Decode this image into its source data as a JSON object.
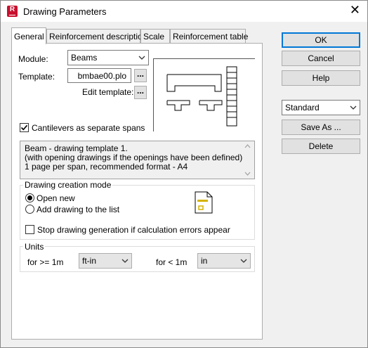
{
  "window": {
    "title": "Drawing Parameters",
    "close_glyph": "✕",
    "app_icon_letter": "R"
  },
  "tabs": [
    {
      "label": "General",
      "active": true
    },
    {
      "label": "Reinforcement description",
      "active": false
    },
    {
      "label": "Scale",
      "active": false
    },
    {
      "label": "Reinforcement table",
      "active": false
    }
  ],
  "general": {
    "module_label": "Module:",
    "module_value": "Beams",
    "template_label": "Template:",
    "template_value": "bmbae00.plo",
    "browse_label": "...",
    "edit_template_label": "Edit template:",
    "edit_btn_label": "...",
    "cantilevers_label": "Cantilevers as separate spans",
    "cantilevers_checked": true,
    "description_lines": [
      "Beam - drawing template 1.",
      "(with opening drawings if the openings have been defined)",
      "1 page per span, recommended format - A4"
    ],
    "creation_mode": {
      "title": "Drawing creation mode",
      "open_new_label": "Open new",
      "add_drawing_label": "Add drawing to the list",
      "selected": "open_new",
      "stop_label": "Stop drawing generation if calculation errors appear",
      "stop_checked": false
    },
    "units": {
      "title": "Units",
      "ge1m_label": "for >= 1m",
      "ge1m_value": "ft-in",
      "lt1m_label": "for < 1m",
      "lt1m_value": "in"
    }
  },
  "side": {
    "ok_label": "OK",
    "cancel_label": "Cancel",
    "help_label": "Help",
    "preset_value": "Standard",
    "save_as_label": "Save As ...",
    "delete_label": "Delete"
  },
  "colors": {
    "accent": "#0078d7",
    "brand": "#c8102e"
  }
}
